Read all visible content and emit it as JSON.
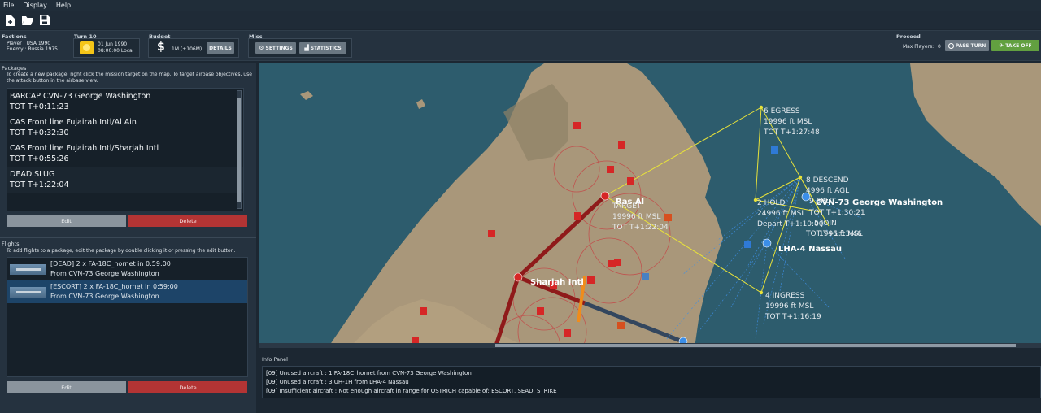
{
  "menu": {
    "file": "File",
    "display": "Display",
    "help": "Help"
  },
  "toolbar": {
    "new_icon": "file-plus-icon",
    "open_icon": "folder-open-icon",
    "save_icon": "floppy-icon"
  },
  "factions": {
    "label": "Factions",
    "player": "Player : USA 1990",
    "enemy": "Enemy : Russia 1975"
  },
  "turn": {
    "label": "Turn 10",
    "date": "01 Jun 1990",
    "time": "08:00:00 Local"
  },
  "budget": {
    "label": "Budget",
    "value": "1M (+106M)",
    "details": "DETAILS"
  },
  "misc": {
    "label": "Misc",
    "settings": "SETTINGS",
    "statistics": "STATISTICS"
  },
  "proceed": {
    "label": "Proceed",
    "max_players_label": "Max Players:",
    "max_players": "0",
    "pass_turn": "PASS TURN",
    "take_off": "TAKE OFF"
  },
  "packages": {
    "title": "Packages",
    "hint": "To create a new package, right click the mission target on the map. To target airbase objectives, use the attack button in the airbase view.",
    "items": [
      {
        "name": "BARCAP CVN-73 George Washington",
        "tot": "TOT T+0:11:23"
      },
      {
        "name": "CAS Front line Fujairah Intl/Al Ain",
        "tot": "TOT T+0:32:30"
      },
      {
        "name": "CAS Front line Fujairah Intl/Sharjah Intl",
        "tot": "TOT T+0:55:26"
      },
      {
        "name": "DEAD SLUG",
        "tot": "TOT T+1:22:04"
      }
    ],
    "edit": "Edit",
    "delete": "Delete"
  },
  "flights": {
    "title": "Flights",
    "hint": "To add flights to a package, edit the package by double clicking it or pressing the edit button.",
    "items": [
      {
        "line1": "[DEAD] 2 x FA-18C_hornet in 0:59:00",
        "line2": "From CVN-73 George Washington"
      },
      {
        "line1": "[ESCORT] 2 x FA-18C_hornet in 0:59:00",
        "line2": "From CVN-73 George Washington"
      }
    ],
    "edit": "Edit",
    "delete": "Delete"
  },
  "map": {
    "bases": {
      "ras": "Ras Al",
      "sharjah": "Sharjah Intl",
      "cvn": "CVN-73 George Washington",
      "lha": "LHA-4 Nassau"
    },
    "wp_egress": [
      "6 EGRESS",
      "19996 ft MSL",
      "TOT T+1:27:48"
    ],
    "wp_target": [
      "TARGET",
      "19996 ft MSL",
      "TOT T+1:22:04"
    ],
    "wp_descend": [
      "8 DESCEND",
      "4996 ft AGL"
    ],
    "wp_split": "9 SPLIT",
    "wp_cvn": "0 CVN-73 George Washington",
    "wp_tot1": "TOT T+1:30:21",
    "wp_5": "5 JOIN",
    "wp_msl2": "1996 ft MSL",
    "wp_tot2": "TOT T+1:13:46",
    "wp_hold": [
      "2 HOLD",
      "24996 ft MSL",
      "Depart T+1:10:00"
    ],
    "wp_ingress": [
      "4 INGRESS",
      "19996 ft MSL",
      "TOT T+1:16:19"
    ],
    "colors": {
      "sea": "#2d5c6d",
      "land": "#a8987a",
      "enemy": "#c21f1f",
      "friendly": "#3b8ee8",
      "route": "#e8e23a"
    }
  },
  "info": {
    "title": "Info Panel",
    "lines": [
      "[09] Unused aircraft : 1 FA-18C_hornet from CVN-73 George Washington",
      "[09] Unused aircraft : 3 UH-1H from LHA-4 Nassau",
      "[09] Insufficient aircraft : Not enough aircraft in range for OSTRICH capable of: ESCORT, SEAD, STRIKE"
    ]
  }
}
